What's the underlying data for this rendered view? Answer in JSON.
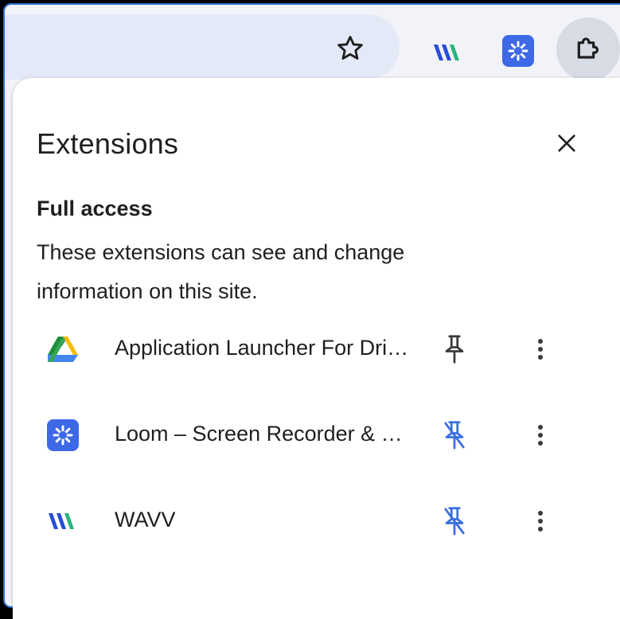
{
  "toolbar": {
    "star_icon": "star-outline-icon",
    "wavv_icon": "wavv-logo-icon",
    "loom_icon": "loom-logo-icon",
    "extensions_icon": "puzzle-piece-icon"
  },
  "panel": {
    "title": "Extensions",
    "close_icon": "close-icon",
    "section": {
      "heading": "Full access",
      "description": "These extensions can see and change information on this site."
    },
    "extensions": [
      {
        "name": "Application Launcher For Drive (by Google)",
        "icon": "google-drive-icon",
        "pinned": true
      },
      {
        "name": "Loom – Screen Recorder & Screen Capture",
        "icon": "loom-logo-icon",
        "pinned": false
      },
      {
        "name": "WAVV",
        "icon": "wavv-logo-icon",
        "pinned": false
      }
    ]
  },
  "colors": {
    "accent": "#2f6fd6",
    "pin_unpinned": "#3c6fe0",
    "pin_pinned": "#3a3a3a",
    "loom": "#3d68e6",
    "wavv_blue": "#2a4bd8",
    "wavv_green": "#27b57a"
  }
}
